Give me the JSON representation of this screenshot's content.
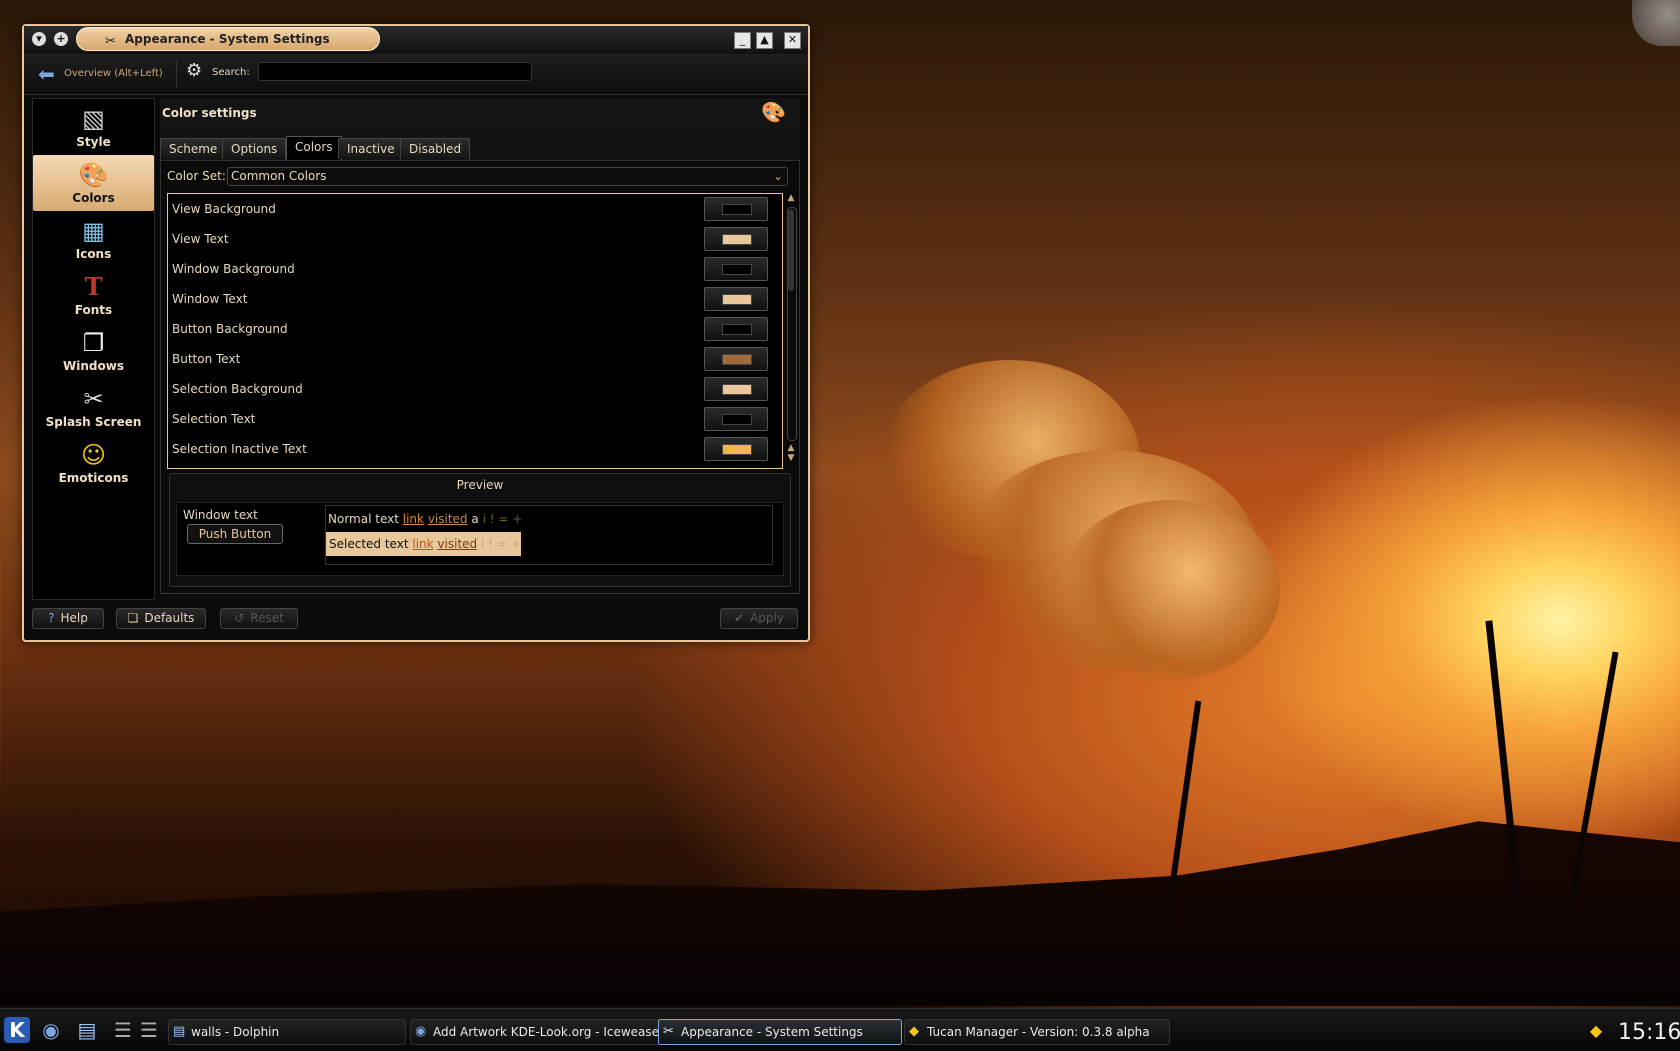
{
  "window": {
    "title": "Appearance - System Settings",
    "min_label": "▁",
    "max_label": "⏶",
    "close_label": "✕"
  },
  "toolbar": {
    "overview_label": "Overview (Alt+Left)",
    "search_label": "Search:",
    "search_value": ""
  },
  "sidebar": {
    "items": [
      {
        "label": "Style",
        "icon": "style-icon"
      },
      {
        "label": "Colors",
        "icon": "colors-icon",
        "selected": true
      },
      {
        "label": "Icons",
        "icon": "icons-icon"
      },
      {
        "label": "Fonts",
        "icon": "fonts-icon"
      },
      {
        "label": "Windows",
        "icon": "windows-icon"
      },
      {
        "label": "Splash Screen",
        "icon": "splash-screen-icon"
      },
      {
        "label": "Emoticons",
        "icon": "emoticons-icon"
      }
    ]
  },
  "page": {
    "title": "Color settings"
  },
  "tabs": [
    "Scheme",
    "Options",
    "Colors",
    "Inactive",
    "Disabled"
  ],
  "active_tab": "Colors",
  "color_set": {
    "label": "Color Set:",
    "value": "Common Colors"
  },
  "roles": [
    {
      "label": "View Background",
      "color": "#000000"
    },
    {
      "label": "View Text",
      "color": "#e8c79a"
    },
    {
      "label": "Window Background",
      "color": "#000000"
    },
    {
      "label": "Window Text",
      "color": "#e8c79a"
    },
    {
      "label": "Button Background",
      "color": "#000000"
    },
    {
      "label": "Button Text",
      "color": "#a06a3a"
    },
    {
      "label": "Selection Background",
      "color": "#e8c79a"
    },
    {
      "label": "Selection Text",
      "color": "#000000"
    },
    {
      "label": "Selection Inactive Text",
      "color": "#f0b54e"
    }
  ],
  "preview": {
    "title": "Preview",
    "window_text": "Window text",
    "push_button": "Push Button",
    "normal_text": "Normal text",
    "selected_text": "Selected text",
    "link": "link",
    "visited": "visited",
    "extra": "a",
    "marks": "i  !  =  +"
  },
  "buttons": {
    "help": "Help",
    "defaults": "Defaults",
    "reset": "Reset",
    "apply": "Apply"
  },
  "taskbar": {
    "tasks": [
      {
        "label": "walls - Dolphin"
      },
      {
        "label": "Add Artwork KDE-Look.org - Iceweasel"
      },
      {
        "label": "Appearance - System Settings",
        "active": true
      },
      {
        "label": "Tucan Manager - Version:  0.3.8 alpha"
      }
    ],
    "clock": "15:16"
  }
}
